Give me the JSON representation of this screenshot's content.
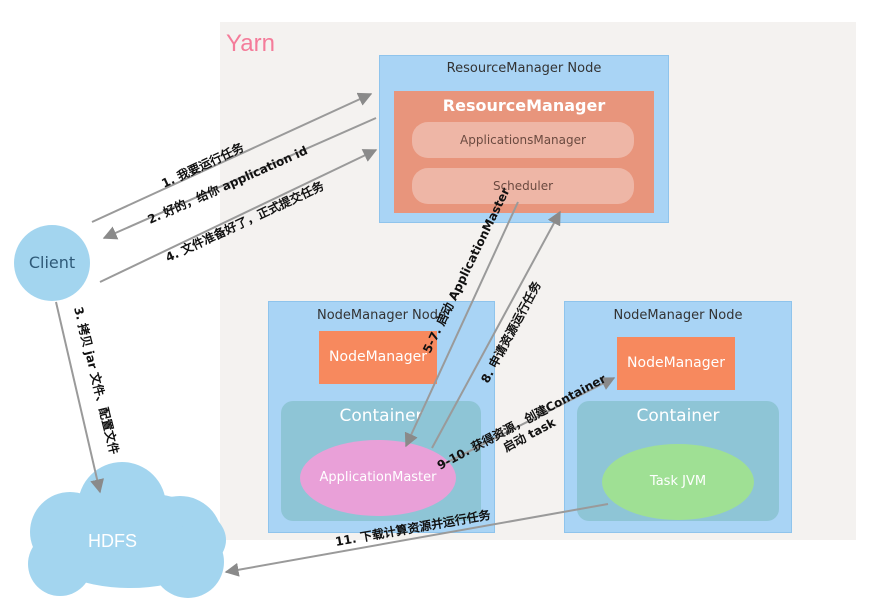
{
  "yarn": {
    "label": "Yarn"
  },
  "resource_manager_node": {
    "title": "ResourceManager Node",
    "resource_manager": "ResourceManager",
    "applications_manager": "ApplicationsManager",
    "scheduler": "Scheduler"
  },
  "node_manager_node_1": {
    "title": "NodeManager Node",
    "node_manager": "NodeManager",
    "container": "Container",
    "application_master": "ApplicationMaster"
  },
  "node_manager_node_2": {
    "title": "NodeManager Node",
    "node_manager": "NodeManager",
    "container": "Container",
    "task_jvm": "Task JVM"
  },
  "client": {
    "label": "Client"
  },
  "hdfs": {
    "label": "HDFS"
  },
  "steps": {
    "s1": "1. 我要运行任务",
    "s2": "2. 好的，给你 application id",
    "s3": "3. 拷贝 jar 文件、配置文件",
    "s4": "4. 文件准备好了，正式提交任务",
    "s5": "5-7. 启动 ApplicationMaster",
    "s8": "8. 申请资源运行任务",
    "s9a": "9-10. 获得资源，创建Container",
    "s9b": "启动 task",
    "s11": "11. 下载计算资源并运行任务"
  },
  "colors": {
    "yarn_label": "#f47c9a",
    "node_bg": "#a9d4f5",
    "resource_manager": "#e8957c",
    "node_manager": "#f7895e",
    "container": "#8ec5d6",
    "application_master": "#e9a0d8",
    "task_jvm": "#9fe094",
    "client": "#a3d5ef",
    "hdfs": "#a3d5ef",
    "arrow": "#9a9a9a"
  }
}
